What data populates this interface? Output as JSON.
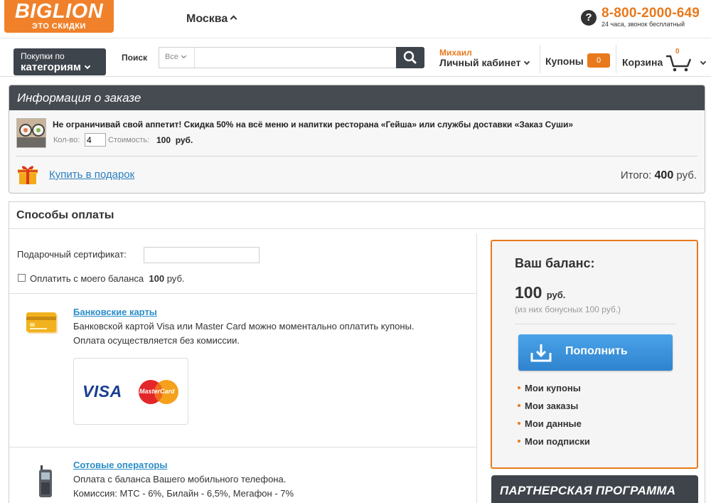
{
  "header": {
    "logo_main": "BIGLION",
    "logo_sub": "ЭТО СКИДКИ",
    "city": "Москва",
    "phone": "8-800-2000-649",
    "phone_note": "24 часа, звонок бесплатный",
    "help_icon": "?"
  },
  "nav": {
    "categories_small": "Покупки по",
    "categories_big": "категориям",
    "search_label": "Поиск",
    "search_scope": "Все",
    "search_value": "",
    "user_name": "Михаил",
    "cabinet": "Личный кабинет",
    "coupons": "Купоны",
    "coupons_count": "0",
    "cart": "Корзина",
    "cart_count": "0"
  },
  "order": {
    "title": "Информация о заказе",
    "deal_title": "Не ограничивай свой аппетит! Скидка 50% на всё меню и напитки ресторана «Гейша» или службы доставки «Заказ Суши»",
    "qty_label": "Кол-во:",
    "qty_value": "4",
    "cost_label": "Стоимость:",
    "cost_value": "100",
    "cost_unit": "руб.",
    "gift_link": "Купить в подарок",
    "total_label": "Итого:",
    "total_value": "400",
    "total_unit": "руб."
  },
  "payment": {
    "title": "Способы оплаты",
    "cert_label": "Подарочный сертификат:",
    "balance_label": "Оплатить с моего баланса",
    "balance_value": "100",
    "balance_unit": "руб.",
    "cards_title": "Банковские карты",
    "cards_text_1": "Банковской картой Visa или Master Card можно моментально оплатить купоны.",
    "cards_text_2": "Оплата осуществляется без комиссии.",
    "visa": "VISA",
    "mastercard": "MasterCard",
    "mobile_title": "Сотовые операторы",
    "mobile_text_1": "Оплата с баланса Вашего мобильного телефона.",
    "mobile_text_2": "Комиссия: МТС - 6%, Билайн - 6,5%, Мегафон - 7%"
  },
  "balance_box": {
    "title": "Ваш баланс:",
    "amount": "100",
    "unit": "руб.",
    "bonus": "(из них бонусных 100 руб.)",
    "topup": "Пополнить",
    "menu": [
      "Мои купоны",
      "Мои заказы",
      "Мои данные",
      "Мои подписки"
    ]
  },
  "partner": "ПАРТНЕРСКАЯ ПРОГРАММА",
  "colors": {
    "accent": "#e8791c",
    "dark": "#464b52",
    "link": "#2a8ec9",
    "button": "#3a92dd"
  }
}
